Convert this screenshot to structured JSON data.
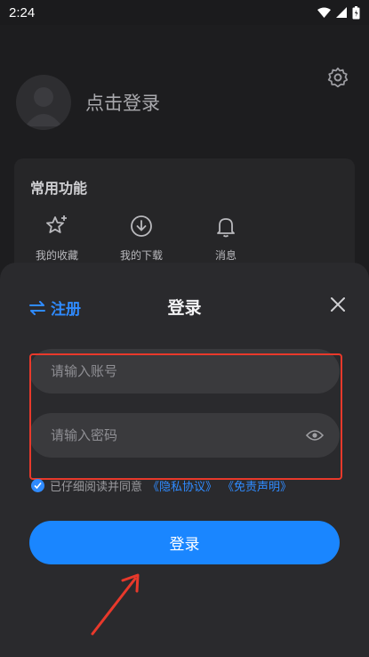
{
  "status_bar": {
    "time": "2:24"
  },
  "profile": {
    "login_prompt": "点击登录"
  },
  "features": {
    "title": "常用功能",
    "items": [
      {
        "label": "我的收藏",
        "icon": "star-plus-icon"
      },
      {
        "label": "我的下载",
        "icon": "download-icon"
      },
      {
        "label": "消息",
        "icon": "bell-icon"
      }
    ]
  },
  "login_sheet": {
    "register_label": "注册",
    "title": "登录",
    "account_placeholder": "请输入账号",
    "password_placeholder": "请输入密码",
    "agree_text": "已仔细阅读并同意",
    "privacy_link": "《隐私协议》",
    "disclaimer_link": "《免责声明》",
    "login_button": "登录"
  },
  "colors": {
    "accent": "#1a86ff",
    "highlight": "#e8392b",
    "sheet_bg": "#2a2a2d"
  }
}
